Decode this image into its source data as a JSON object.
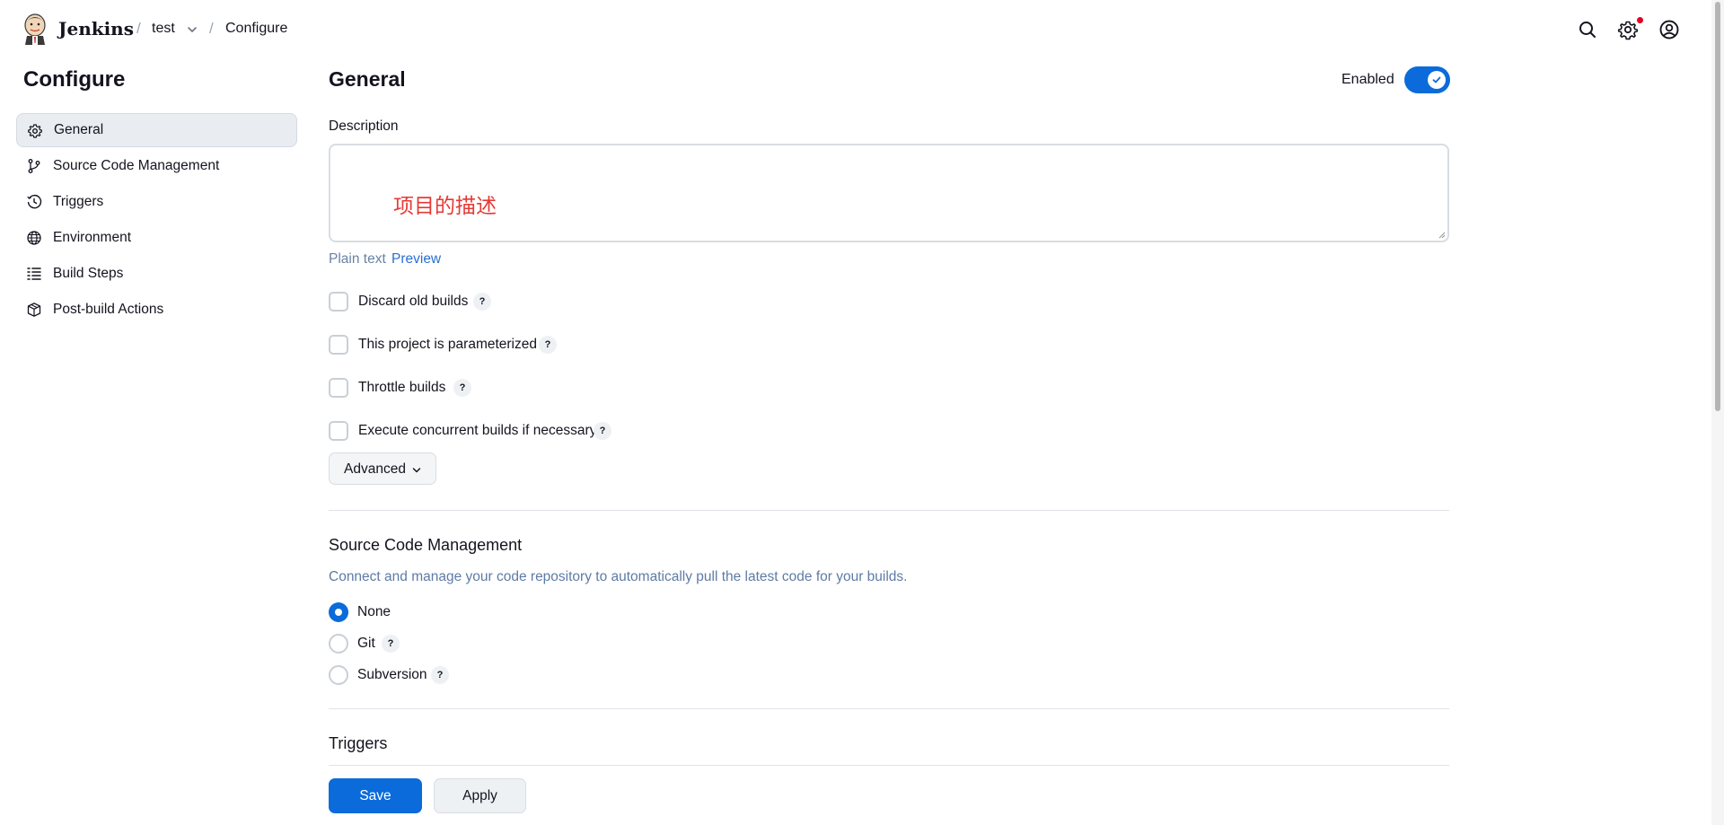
{
  "header": {
    "brand": "Jenkins",
    "breadcrumb": [
      {
        "label": "test"
      },
      {
        "label": "Configure"
      }
    ],
    "separator": "/",
    "icons": [
      "search-icon",
      "settings-icon",
      "user-icon"
    ]
  },
  "sidebar": {
    "title": "Configure",
    "items": [
      {
        "label": "General",
        "icon": "gear-icon",
        "active": true
      },
      {
        "label": "Source Code Management",
        "icon": "branch-icon"
      },
      {
        "label": "Triggers",
        "icon": "clock-icon"
      },
      {
        "label": "Environment",
        "icon": "globe-icon"
      },
      {
        "label": "Build Steps",
        "icon": "list-icon"
      },
      {
        "label": "Post-build Actions",
        "icon": "package-icon"
      }
    ]
  },
  "general": {
    "title": "General",
    "enabled_label": "Enabled",
    "enabled": true,
    "description_label": "Description",
    "description_value": "项目的描述",
    "plain_text": "Plain text",
    "preview": "Preview",
    "options": [
      {
        "label": "Discard old builds",
        "checked": false
      },
      {
        "label": "This project is parameterized",
        "checked": false
      },
      {
        "label": "Throttle builds",
        "checked": false
      },
      {
        "label": "Execute concurrent builds if necessary",
        "checked": false
      }
    ],
    "help_mark": "?",
    "advanced_label": "Advanced"
  },
  "scm": {
    "title": "Source Code Management",
    "description": "Connect and manage your code repository to automatically pull the latest code for your builds.",
    "options": [
      {
        "label": "None",
        "selected": true
      },
      {
        "label": "Git",
        "selected": false
      },
      {
        "label": "Subversion",
        "selected": false
      }
    ]
  },
  "triggers": {
    "title": "Triggers"
  },
  "footer": {
    "save_label": "Save",
    "apply_label": "Apply"
  },
  "colors": {
    "accent": "#0b6bda",
    "description_text": "#e53935"
  }
}
